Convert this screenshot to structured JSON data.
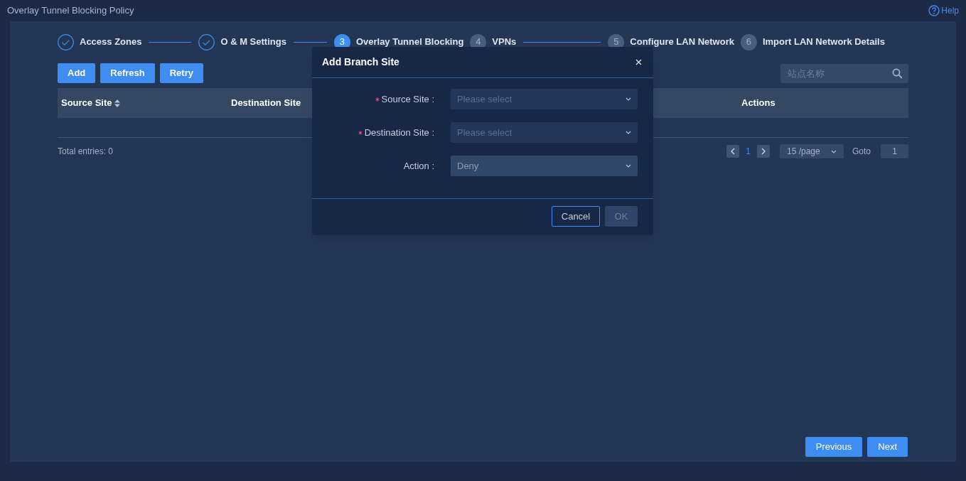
{
  "page_title": "Overlay Tunnel Blocking Policy",
  "help": {
    "label": "Help"
  },
  "steps": [
    {
      "label": "Access Zones",
      "completed": true,
      "selected": false,
      "connector_after": true
    },
    {
      "label": "O & M Settings",
      "completed": true,
      "selected": false,
      "connector_after": true
    },
    {
      "number": "3",
      "label": "Overlay Tunnel Blocking",
      "completed": false,
      "selected": true,
      "connector_after": false
    },
    {
      "number": "4",
      "label": "VPNs",
      "completed": false,
      "selected": false,
      "connector_after": true
    },
    {
      "number": "5",
      "label": "Configure LAN Network",
      "completed": false,
      "selected": false,
      "connector_after": false
    },
    {
      "number": "6",
      "label": "Import LAN Network Details",
      "completed": false,
      "selected": false,
      "connector_after": false
    }
  ],
  "toolbar_buttons": [
    "Add",
    "Refresh",
    "Retry"
  ],
  "search": {
    "placeholder": "站点名称"
  },
  "table": {
    "columns": [
      {
        "label": "Source Site",
        "sortable": true
      },
      {
        "label": "Destination Site",
        "sortable": false
      },
      {
        "label": "Actions",
        "sortable": false
      }
    ]
  },
  "total_entries": "Total entries: 0",
  "pagination": {
    "pages": [
      {
        "label": "1",
        "selected": true
      }
    ],
    "page_size": "15 /page",
    "goto_label": "Goto",
    "goto_value": "1"
  },
  "footer_buttons": [
    {
      "label": "Previous"
    },
    {
      "label": "Next"
    }
  ],
  "dialog": {
    "title": "Add Branch Site",
    "fields": [
      {
        "label": "Source Site :",
        "required": true,
        "placeholder": "Please select"
      },
      {
        "label": "Destination Site :",
        "required": true,
        "placeholder": "Please select"
      },
      {
        "label": "Action :",
        "required": false,
        "value": "Deny"
      }
    ],
    "buttons": [
      {
        "label": "Cancel",
        "disabled": false
      },
      {
        "label": "OK",
        "disabled": true
      }
    ]
  }
}
